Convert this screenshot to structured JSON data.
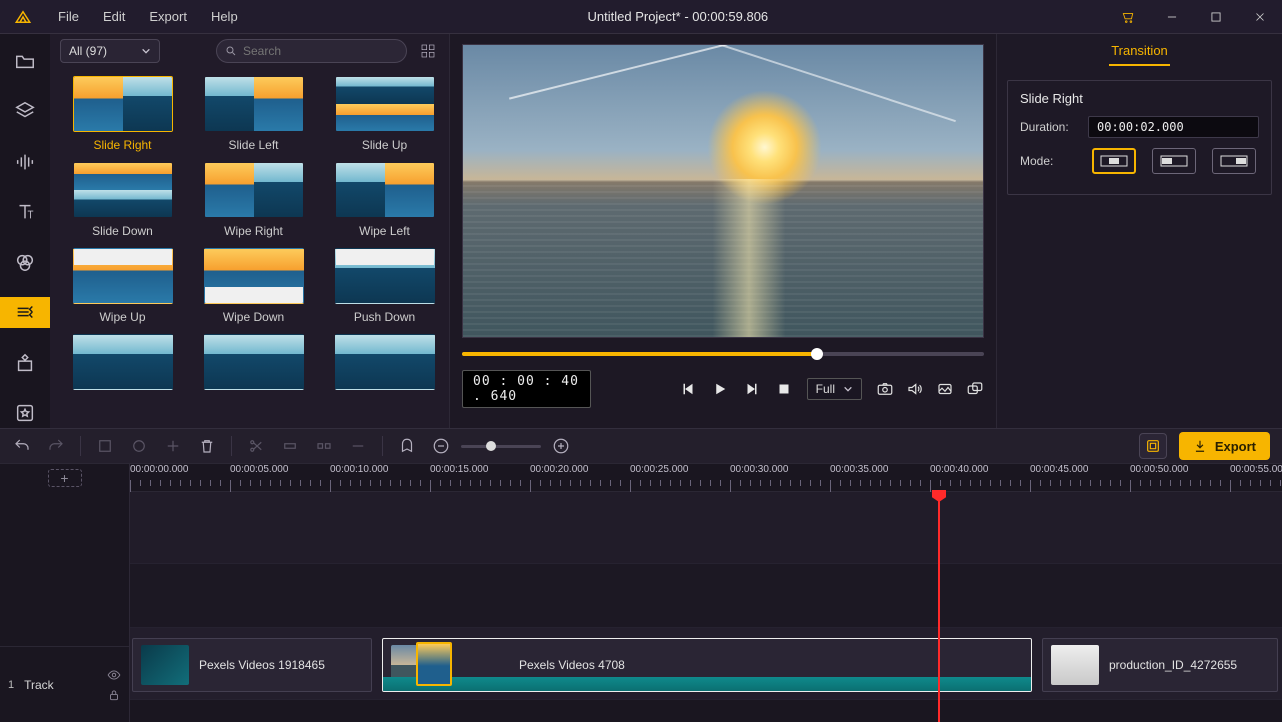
{
  "app": {
    "title": "Untitled Project* - 00:00:59.806",
    "menu": {
      "file": "File",
      "edit": "Edit",
      "export": "Export",
      "help": "Help"
    }
  },
  "browser": {
    "filter_label": "All (97)",
    "search_placeholder": "Search",
    "selected": "Slide Right",
    "items": [
      "Slide Right",
      "Slide Left",
      "Slide Up",
      "Slide Down",
      "Wipe Right",
      "Wipe Left",
      "Wipe Up",
      "Wipe Down",
      "Push Down"
    ]
  },
  "preview": {
    "timecode": "00 : 00 : 40 . 640",
    "size_label": "Full"
  },
  "properties": {
    "tab": "Transition",
    "title": "Slide Right",
    "duration_label": "Duration:",
    "duration_value": "00:00:02.000",
    "mode_label": "Mode:"
  },
  "toolbar": {
    "export": "Export"
  },
  "timeline": {
    "track_number": "1",
    "track_label": "Track",
    "ticks": [
      "00:00:00.000",
      "00:00:05.000",
      "00:00:10.000",
      "00:00:15.000",
      "00:00:20.000",
      "00:00:25.000",
      "00:00:30.000",
      "00:00:35.000",
      "00:00:40.000",
      "00:00:45.000",
      "00:00:50.000",
      "00:00:55.000"
    ],
    "clips": [
      {
        "name": "Pexels Videos 1918465"
      },
      {
        "name": "Pexels Videos 4708"
      },
      {
        "name": "production_ID_4272655"
      }
    ]
  }
}
